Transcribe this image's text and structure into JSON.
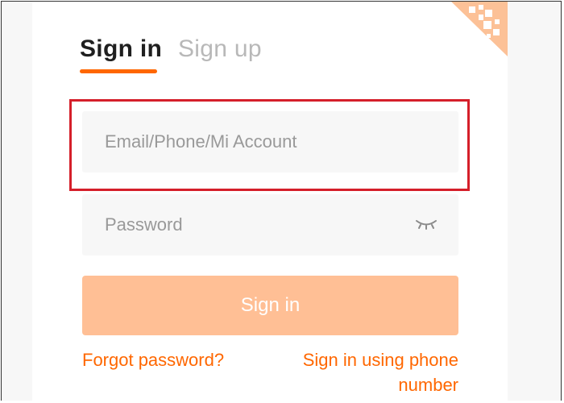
{
  "tabs": {
    "sign_in": "Sign in",
    "sign_up": "Sign up"
  },
  "form": {
    "account_placeholder": "Email/Phone/Mi Account",
    "password_placeholder": "Password",
    "submit_label": "Sign in"
  },
  "links": {
    "forgot_password": "Forgot password?",
    "phone_signin": "Sign in using phone number"
  },
  "icons": {
    "qr_corner": "qr-code-icon",
    "password_toggle": "eye-closed-icon"
  },
  "colors": {
    "accent": "#ff6700",
    "button_disabled": "#ffbf95",
    "highlight_border": "#d51f2a",
    "input_bg": "#f7f7f7"
  }
}
